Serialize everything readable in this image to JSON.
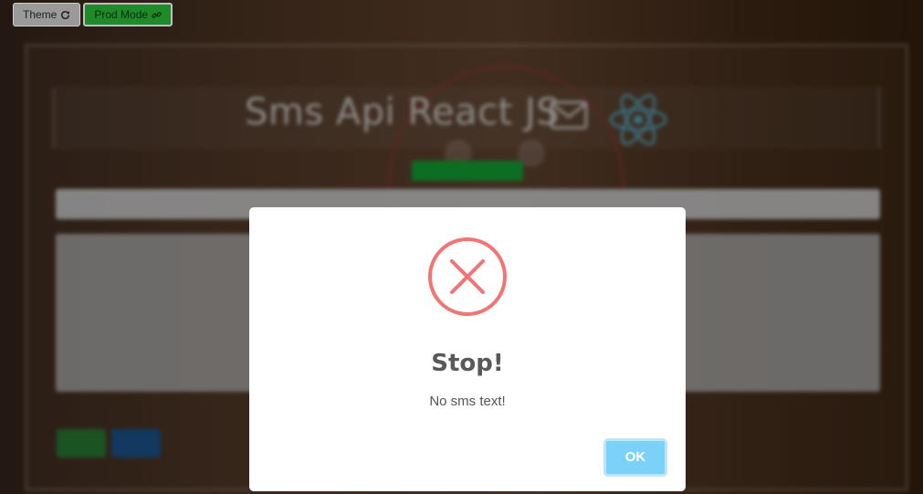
{
  "topbar": {
    "theme_label": "Theme",
    "prod_mode_label": "Prod Mode"
  },
  "app": {
    "title": "Sms Api React JS",
    "status_label": "",
    "phone_value": "",
    "sms_placeholder": "",
    "send_label": "",
    "reset_label": ""
  },
  "modal": {
    "icon": "error-x-icon",
    "title": "Stop!",
    "text": "No sms text!",
    "ok_label": "OK"
  },
  "colors": {
    "prod_mode_green": "#1e8a2a",
    "error_red": "#f27474",
    "ok_blue": "#7cd1f9",
    "react_cyan": "#61dafb",
    "status_green": "#14b83a"
  }
}
